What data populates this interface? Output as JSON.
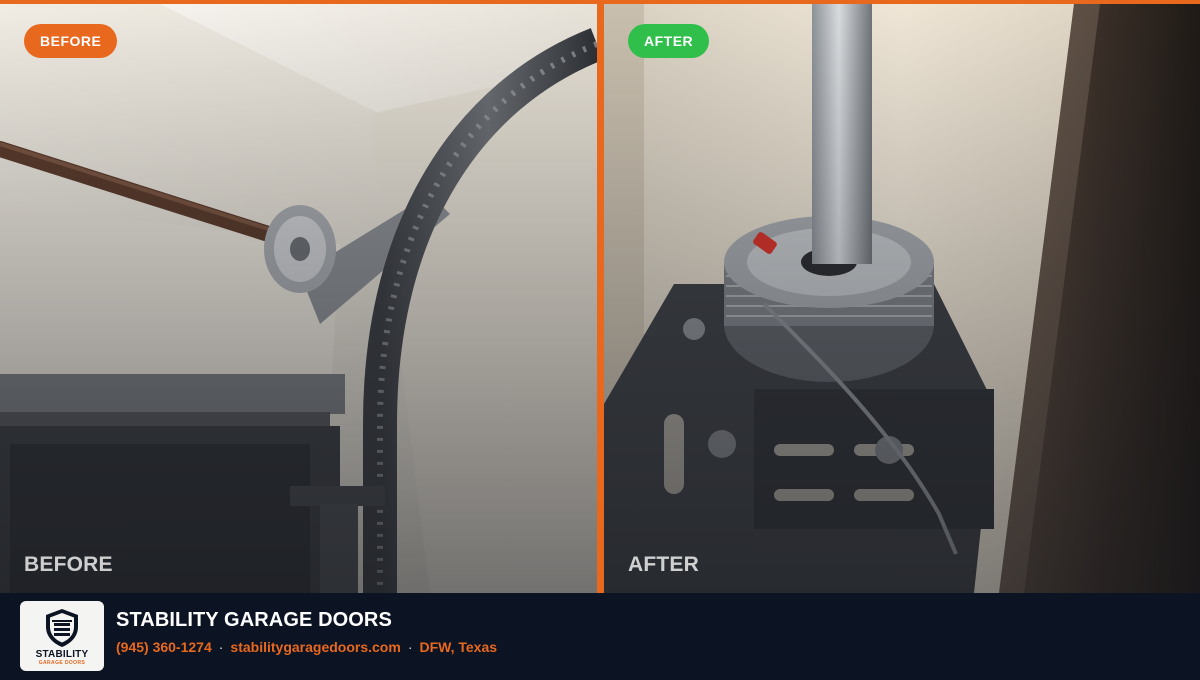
{
  "colors": {
    "accent": "#e8681e",
    "after_badge": "#2fbf4a",
    "footer_bg": "#0c1322"
  },
  "before": {
    "badge": "BEFORE",
    "caption": "BEFORE"
  },
  "after": {
    "badge": "AFTER",
    "caption": "AFTER"
  },
  "footer": {
    "logo_name": "STABILITY",
    "logo_tagline": "GARAGE DOORS",
    "company": "STABILITY GARAGE DOORS",
    "phone": "(945) 360-1274",
    "website": "stabilitygaragedoors.com",
    "location": "DFW, Texas",
    "separator": "·"
  }
}
